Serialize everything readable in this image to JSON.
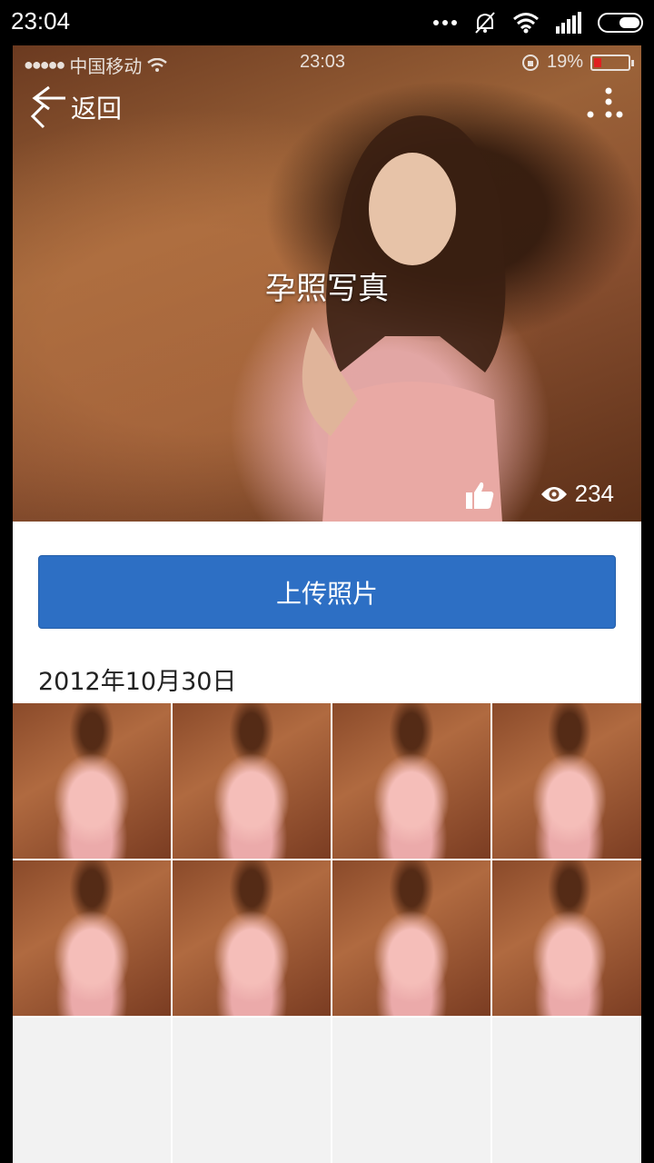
{
  "os_status": {
    "time": "23:04"
  },
  "inner_status": {
    "carrier": "中国移动",
    "time": "23:03",
    "battery": "19%"
  },
  "nav": {
    "back_label": "返回"
  },
  "hero": {
    "title": "孕照写真",
    "view_count": "234"
  },
  "upload_button": "上传照片",
  "album": {
    "date": "2012年10月30日",
    "photos": [
      "photo-1",
      "photo-2",
      "photo-3",
      "photo-4",
      "photo-5",
      "photo-6",
      "photo-7",
      "photo-8"
    ]
  },
  "colors": {
    "primary": "#2d6fc4",
    "background": "#ffffff"
  },
  "icons": [
    "back-arrow-icon",
    "more-icon",
    "thumbs-up-icon",
    "eye-icon",
    "wifi-icon",
    "battery-icon"
  ]
}
